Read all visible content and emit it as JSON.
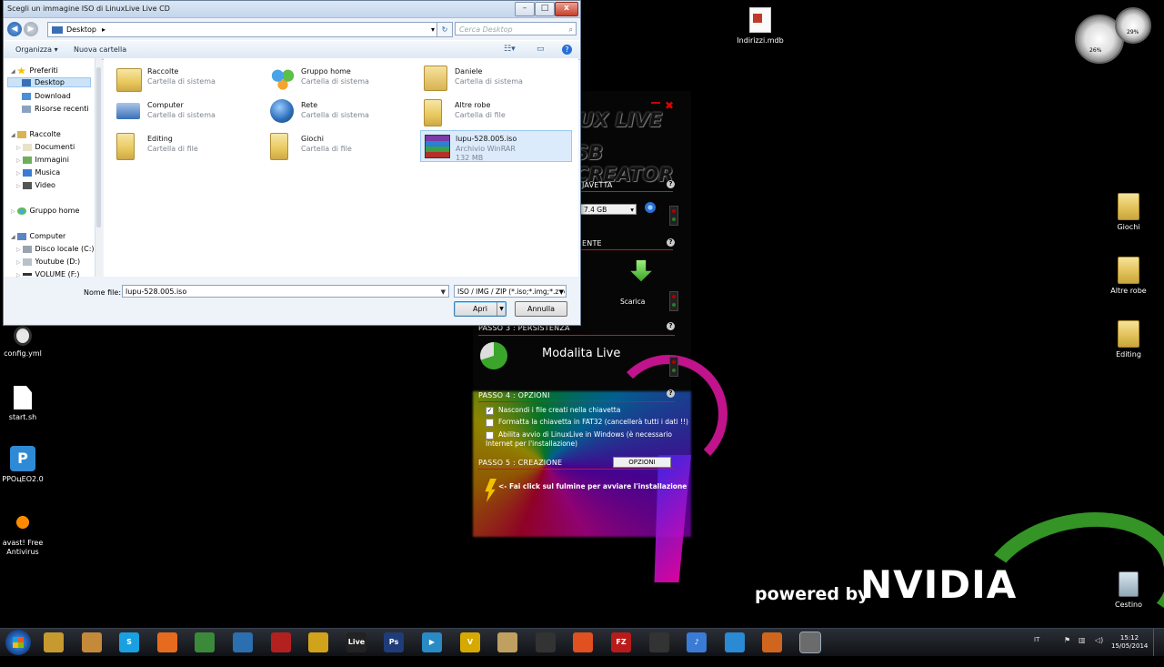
{
  "dialog": {
    "title": "Scegli un immagine ISO di LinuxLive Live CD",
    "address": "Desktop",
    "search_placeholder": "Cerca Desktop",
    "toolbar": {
      "organize": "Organizza ▾",
      "new_folder": "Nuova cartella"
    },
    "nav": [
      {
        "label": "Preferiti"
      },
      {
        "label": "Desktop"
      },
      {
        "label": "Download"
      },
      {
        "label": "Risorse recenti"
      },
      {
        "label": "Raccolte"
      },
      {
        "label": "Documenti"
      },
      {
        "label": "Immagini"
      },
      {
        "label": "Musica"
      },
      {
        "label": "Video"
      },
      {
        "label": "Gruppo home"
      },
      {
        "label": "Computer"
      },
      {
        "label": "Disco locale (C:)"
      },
      {
        "label": "Youtube (D:)"
      },
      {
        "label": "VOLUME (F:)"
      }
    ],
    "items": [
      {
        "name": "Raccolte",
        "type": "Cartella di sistema"
      },
      {
        "name": "Gruppo home",
        "type": "Cartella di sistema"
      },
      {
        "name": "Daniele",
        "type": "Cartella di sistema"
      },
      {
        "name": "Computer",
        "type": "Cartella di sistema"
      },
      {
        "name": "Rete",
        "type": "Cartella di sistema"
      },
      {
        "name": "Altre robe",
        "type": "Cartella di file"
      },
      {
        "name": "Editing",
        "type": "Cartella di file"
      },
      {
        "name": "Giochi",
        "type": "Cartella di file"
      },
      {
        "name": "lupu-528.005.iso",
        "type": "Archivio WinRAR",
        "size": "132 MB"
      }
    ],
    "filename_label": "Nome file:",
    "filename_value": "lupu-528.005.iso",
    "filetype": "ISO / IMG / ZIP (*.iso;*.img;*.zip",
    "open_btn": "Apri",
    "cancel_btn": "Annulla"
  },
  "lili": {
    "logo_line1": "UX LIVE",
    "logo_line2": "SB CREATOR",
    "step1": "JAVETTA",
    "usb_size": "7.4 GB",
    "step2": "ENTE",
    "download": "Scarica",
    "step3": "PASSO 3 : PERSISTENZA",
    "mode": "Modalita Live",
    "step4": "PASSO 4 : OPZIONI",
    "opt1": "Nascondi i file creati nella chiavetta",
    "opt2": "Formatta la chiavetta in FAT32 (cancellerà tutti i dati !!)",
    "opt3": "Abilita avvio di LinuxLive in Windows (è necessario Internet per l'installazione)",
    "step5": "PASSO 5 : CREAZIONE",
    "options_btn": "OPZIONI",
    "lightning_hint": "<- Fai click sul fulmine per avviare l'installazione"
  },
  "desktop": {
    "icons": [
      {
        "label": "Indirizzi.mdb"
      },
      {
        "label": "Giochi"
      },
      {
        "label": "Altre robe"
      },
      {
        "label": "Editing"
      },
      {
        "label": "config.yml"
      },
      {
        "label": "start.sh"
      },
      {
        "label": "PPOцEO2.0"
      },
      {
        "label": "avast! Free Antivirus"
      },
      {
        "label": "Cestino"
      }
    ],
    "gadget_a": "26%",
    "gadget_b": "29%",
    "nvidia_powered": "powered by",
    "nvidia_brand": "NVIDIA"
  },
  "taskbar": {
    "lang": "IT",
    "time": "15:12",
    "date": "15/05/2014",
    "apps": [
      {
        "label": "",
        "color": "#c79a2f"
      },
      {
        "label": "",
        "color": "#c48a3a"
      },
      {
        "label": "S",
        "color": "#1aa0e0"
      },
      {
        "label": "",
        "color": "#e66b1e"
      },
      {
        "label": "",
        "color": "#3b8a3a"
      },
      {
        "label": "",
        "color": "#2b6fb0"
      },
      {
        "label": "",
        "color": "#b32020"
      },
      {
        "label": "",
        "color": "#d1a31a"
      },
      {
        "label": "Live",
        "color": "#222"
      },
      {
        "label": "Ps",
        "color": "#1f3c7a"
      },
      {
        "label": "▶",
        "color": "#2a8ac4"
      },
      {
        "label": "V",
        "color": "#d6a900"
      },
      {
        "label": "",
        "color": "#c0a060"
      },
      {
        "label": "",
        "color": "#333"
      },
      {
        "label": "",
        "color": "#e05020"
      },
      {
        "label": "FZ",
        "color": "#b91b1b"
      },
      {
        "label": "",
        "color": "#333"
      },
      {
        "label": "♪",
        "color": "#3a7bd5"
      },
      {
        "label": "",
        "color": "#2a8ad4"
      },
      {
        "label": "",
        "color": "#d0651e"
      },
      {
        "label": "",
        "color": "#6b6b6b"
      }
    ]
  }
}
